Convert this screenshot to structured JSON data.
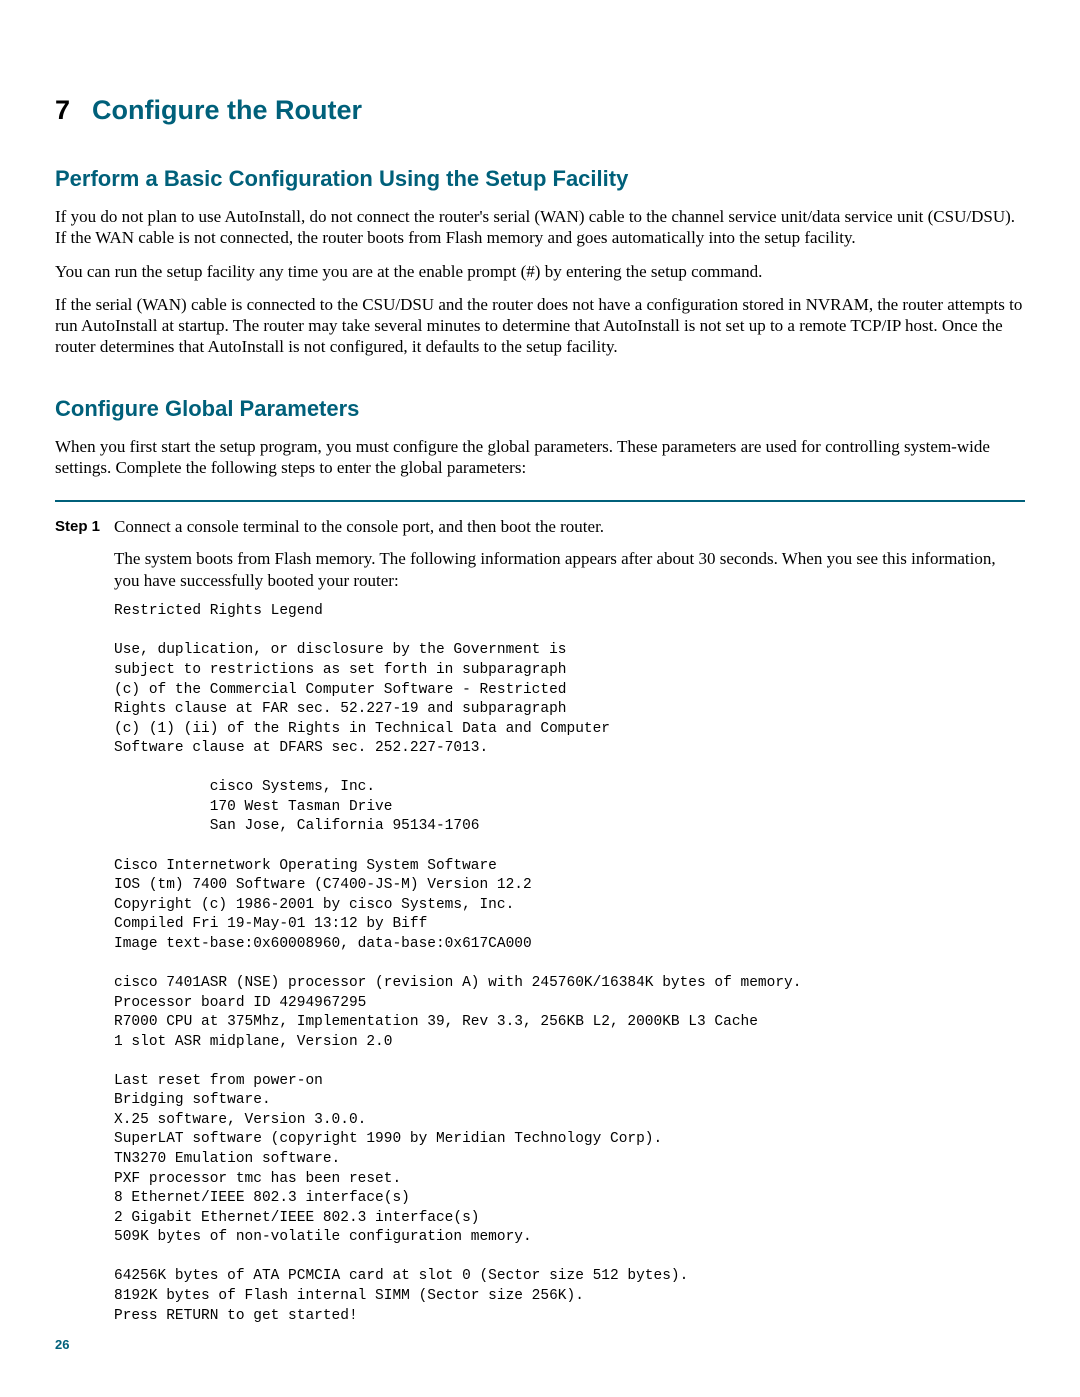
{
  "chapter": {
    "number": "7",
    "title": "Configure the Router"
  },
  "section1": {
    "title": "Perform a Basic Configuration Using the Setup Facility",
    "p1": "If you do not plan to use AutoInstall, do not connect the router's serial (WAN) cable to the channel service unit/data service unit (CSU/DSU). If the WAN cable is not connected, the router boots from Flash memory and goes automatically into the setup facility.",
    "p2": "You can run the setup facility any time you are at the enable prompt (#) by entering the setup command.",
    "p3": "If the serial (WAN) cable is connected to the CSU/DSU and the router does not have a configuration stored in NVRAM, the router attempts to run AutoInstall at startup. The router may take several minutes to determine that AutoInstall is not set up to a remote TCP/IP host. Once the router determines that AutoInstall is not configured, it defaults to the setup facility."
  },
  "section2": {
    "title": "Configure Global Parameters",
    "p1": "When you first start the setup program, you must configure the global parameters. These parameters are used for controlling system-wide settings. Complete the following steps to enter the global parameters:"
  },
  "step1": {
    "label": "Step 1",
    "line1": "Connect a console terminal to the console port, and then boot the router.",
    "line2": "The system boots from Flash memory. The following information appears after about 30 seconds. When you see this information, you have successfully booted your router:",
    "code": "Restricted Rights Legend\n\nUse, duplication, or disclosure by the Government is\nsubject to restrictions as set forth in subparagraph\n(c) of the Commercial Computer Software - Restricted\nRights clause at FAR sec. 52.227-19 and subparagraph\n(c) (1) (ii) of the Rights in Technical Data and Computer\nSoftware clause at DFARS sec. 252.227-7013.\n\n           cisco Systems, Inc.\n           170 West Tasman Drive\n           San Jose, California 95134-1706\n\nCisco Internetwork Operating System Software\nIOS (tm) 7400 Software (C7400-JS-M) Version 12.2\nCopyright (c) 1986-2001 by cisco Systems, Inc.\nCompiled Fri 19-May-01 13:12 by Biff\nImage text-base:0x60008960, data-base:0x617CA000\n\ncisco 7401ASR (NSE) processor (revision A) with 245760K/16384K bytes of memory.\nProcessor board ID 4294967295\nR7000 CPU at 375Mhz, Implementation 39, Rev 3.3, 256KB L2, 2000KB L3 Cache\n1 slot ASR midplane, Version 2.0\n\nLast reset from power-on\nBridging software.\nX.25 software, Version 3.0.0.\nSuperLAT software (copyright 1990 by Meridian Technology Corp).\nTN3270 Emulation software.\nPXF processor tmc has been reset.\n8 Ethernet/IEEE 802.3 interface(s)\n2 Gigabit Ethernet/IEEE 802.3 interface(s)\n509K bytes of non-volatile configuration memory.\n\n64256K bytes of ATA PCMCIA card at slot 0 (Sector size 512 bytes).\n8192K bytes of Flash internal SIMM (Sector size 256K).\nPress RETURN to get started!"
  },
  "pageNumber": "26"
}
